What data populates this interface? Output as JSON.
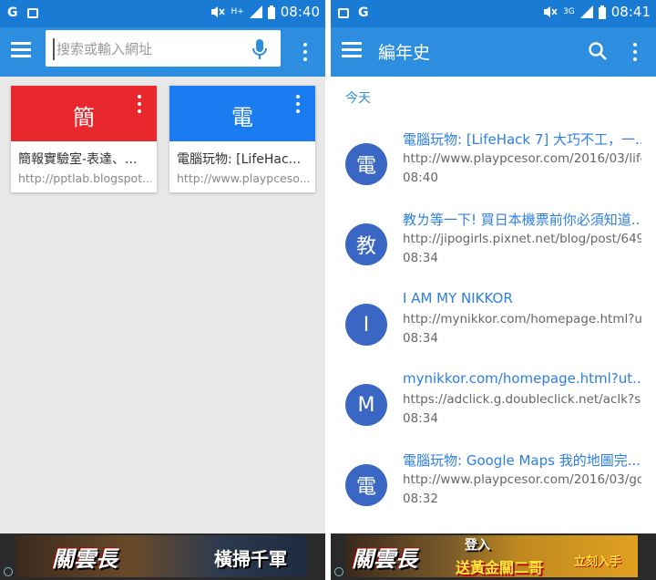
{
  "left_screen": {
    "status_bar": {
      "time": "08:40",
      "network": "H+",
      "icons": [
        "google-g-icon",
        "gallery-icon",
        "mute-icon",
        "signal-icon",
        "battery-icon"
      ]
    },
    "toolbar": {
      "search_placeholder": "搜索或輸入網址",
      "icons": [
        "menu-icon",
        "mic-icon",
        "more-vert-icon"
      ]
    },
    "tiles": [
      {
        "letter": "簡",
        "title": "簡報實驗室-表達、...",
        "url": "http://pptlab.blogspot...",
        "color": "#e8282c"
      },
      {
        "letter": "電",
        "title": "電腦玩物: [LifeHac...",
        "url": "http://www.playpceso...",
        "color": "#1a7cf0"
      }
    ],
    "ad": {
      "brand": "關雲長",
      "slogan": "橫掃千軍"
    }
  },
  "right_screen": {
    "status_bar": {
      "time": "08:41",
      "network": "3G",
      "icons": [
        "gallery-icon",
        "google-g-icon",
        "mute-icon",
        "signal-icon",
        "battery-icon"
      ]
    },
    "app_bar": {
      "title": "編年史",
      "icons": [
        "menu-icon",
        "search-icon",
        "more-vert-icon"
      ]
    },
    "section_label": "今天",
    "history": [
      {
        "letter": "電",
        "title": "電腦玩物: [LifeHack 7] 大巧不工，一...",
        "url": "http://www.playpcesor.com/2016/03/life...",
        "time": "08:40"
      },
      {
        "letter": "教",
        "title": "教ㄌ等一下! 買日本機票前你必須知道...",
        "url": "http://jipogirls.pixnet.net/blog/post/649...",
        "time": "08:34"
      },
      {
        "letter": "I",
        "title": "I AM MY NIKKOR",
        "url": "http://mynikkor.com/homepage.html?ut...",
        "time": "08:34"
      },
      {
        "letter": "M",
        "title": "mynikkor.com/homepage.html?ut...",
        "url": "https://adclick.g.doubleclick.net/aclk?sa...",
        "time": "08:34"
      },
      {
        "letter": "電",
        "title": "電腦玩物: Google Maps 我的地圖完...",
        "url": "http://www.playpcesor.com/2016/03/go...",
        "time": "08:32"
      }
    ],
    "ad": {
      "brand": "關雲長",
      "slogan": "登入",
      "slogan2": "送黃金關二哥",
      "slogan3": "立刻入手"
    }
  }
}
